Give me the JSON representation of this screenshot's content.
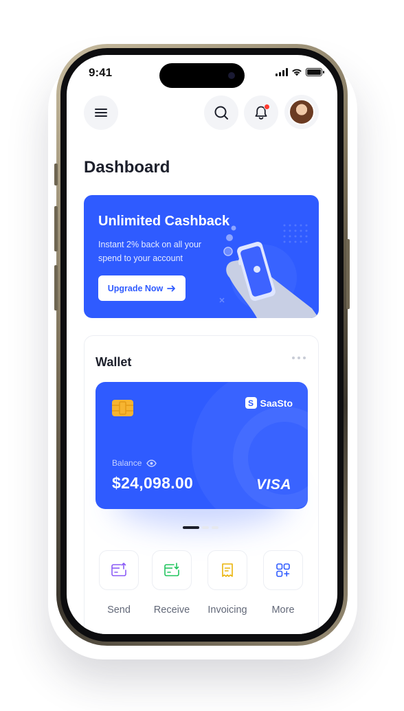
{
  "status_bar": {
    "time": "9:41"
  },
  "header": {
    "title": "Dashboard"
  },
  "promo": {
    "title": "Unlimited Cashback",
    "subtitle": "Instant 2% back on all your spend to your account",
    "cta_label": "Upgrade Now",
    "cta_icon": "arrow-right-icon"
  },
  "wallet": {
    "title": "Wallet",
    "card": {
      "brand": "SaaSto",
      "balance_label": "Balance",
      "balance_value": "$24,098.00",
      "network": "VISA"
    },
    "pagination": {
      "count": 3,
      "active_index": 0
    },
    "actions": [
      {
        "label": "Send",
        "icon": "send-card-icon",
        "color": "#8b5cf6"
      },
      {
        "label": "Receive",
        "icon": "receive-card-icon",
        "color": "#22c55e"
      },
      {
        "label": "Invoicing",
        "icon": "invoice-icon",
        "color": "#eab308"
      },
      {
        "label": "More",
        "icon": "grid-plus-icon",
        "color": "#2f5bff"
      }
    ]
  },
  "colors": {
    "accent": "#2f5bff",
    "text_dark": "#1c1f2b",
    "notification": "#ff3b30",
    "chip": "#f6b431"
  }
}
